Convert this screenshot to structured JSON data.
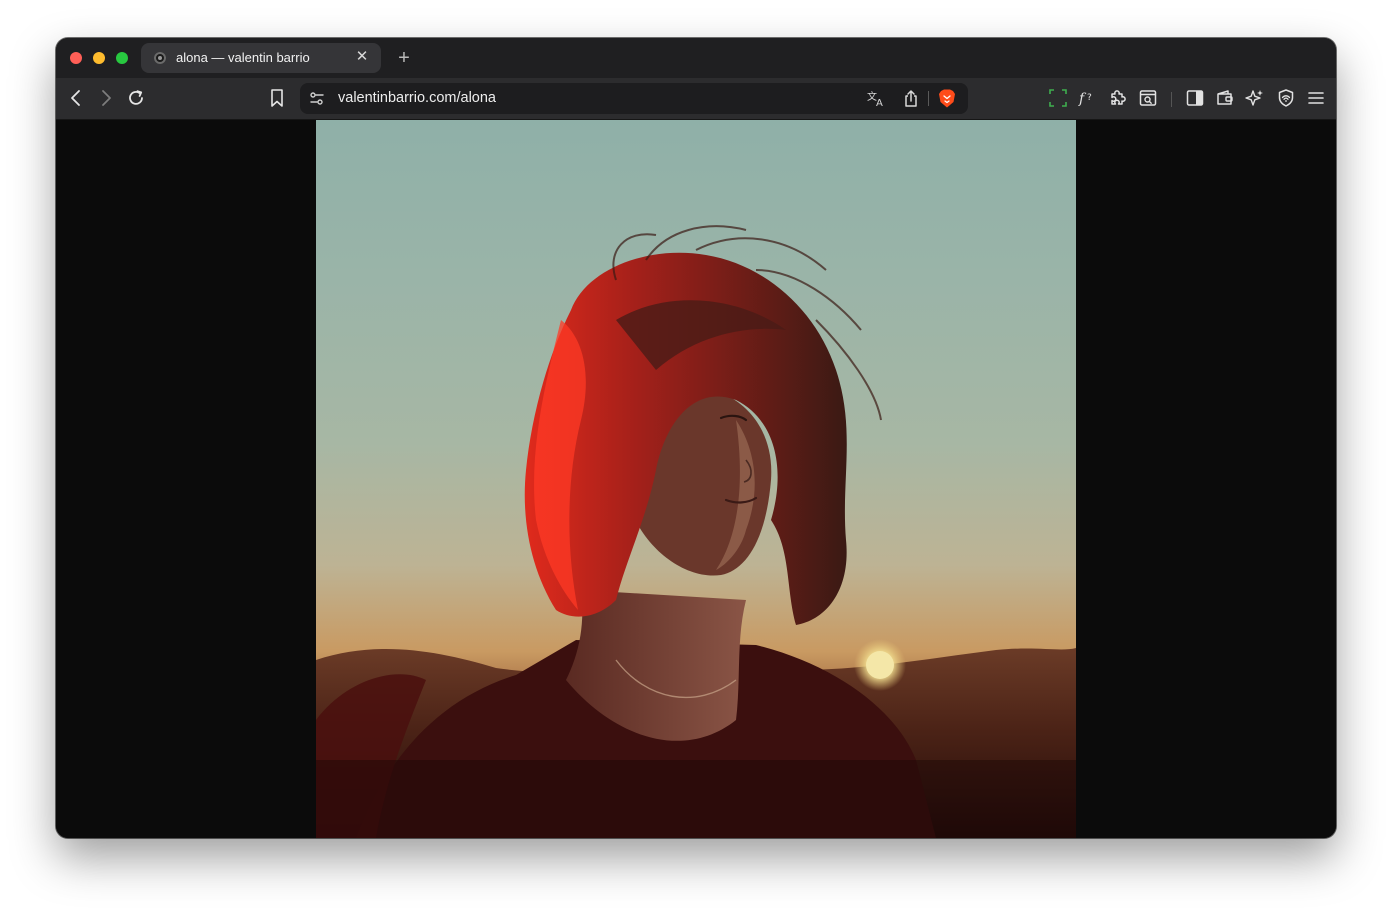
{
  "window": {
    "traffic_lights": {
      "close": "#ff5f57",
      "minimize": "#febc2e",
      "maximize": "#28c840"
    }
  },
  "tabs": [
    {
      "title": "alona — valentin barrio",
      "active": true,
      "favicon": "site-favicon-icon",
      "close_glyph": "✕"
    }
  ],
  "new_tab_glyph": "+",
  "toolbar": {
    "nav_icons": [
      "back-icon",
      "forward-icon",
      "reload-icon",
      "bookmark-icon"
    ],
    "url": "valentinbarrio.com/alona",
    "url_icons": [
      "site-info-icon",
      "translate-icon",
      "share-icon",
      "brave-shields-icon"
    ],
    "right_icons": [
      "screenshot-icon",
      "formula-icon",
      "extensions-icon",
      "search-page-icon",
      "sidebar-icon",
      "wallet-icon",
      "leo-ai-icon",
      "vpn-shield-icon",
      "menu-icon"
    ]
  },
  "page": {
    "background": "#0b0b0b",
    "photo": {
      "subject": "portrait-photo",
      "accent": "#d42a1e"
    }
  }
}
